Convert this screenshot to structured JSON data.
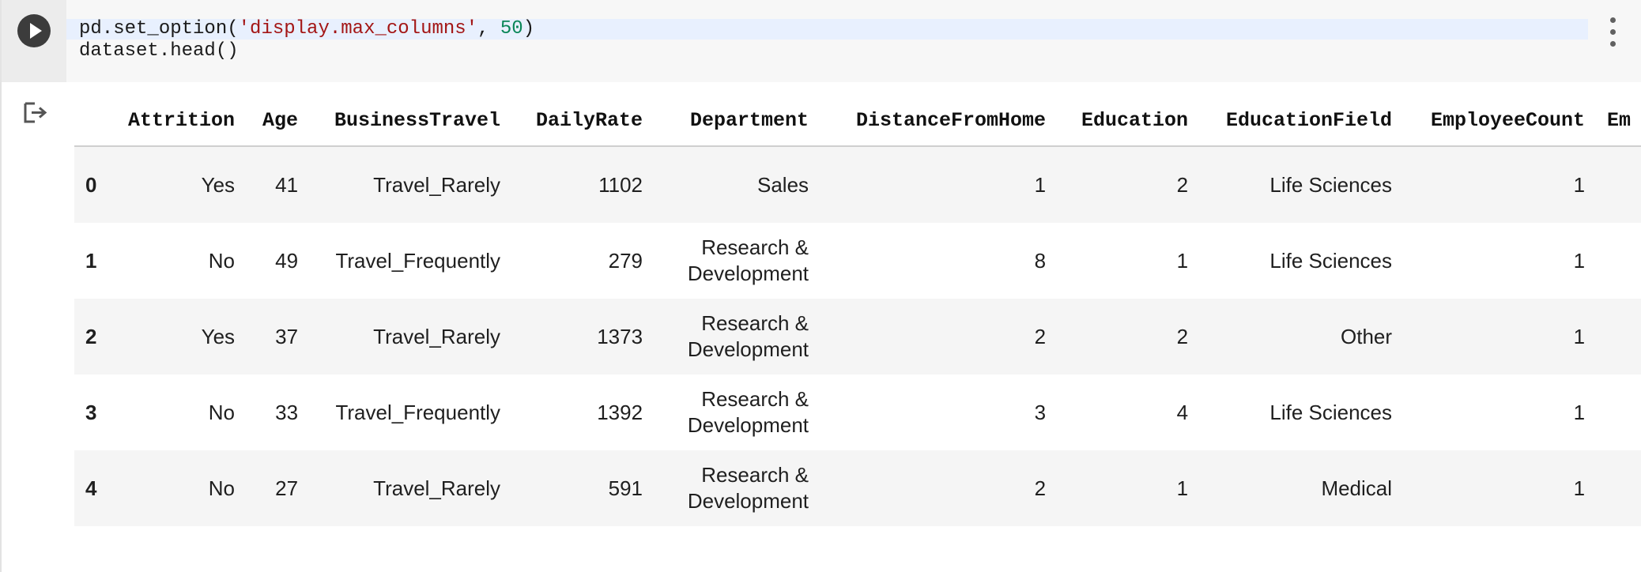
{
  "code_cell": {
    "line1": {
      "prefix": "pd.set_option(",
      "string": "'display.max_columns'",
      "separator": ", ",
      "number": "50",
      "suffix": ")"
    },
    "line2": "dataset.head()"
  },
  "icons": {
    "run": "play-icon",
    "menu": "more-vertical-icon",
    "output": "output-redirect-icon"
  },
  "colors": {
    "gutter_bg": "#ececec",
    "input_bg": "#f7f7f7",
    "current_line_bg": "#e8f0fe",
    "string_token": "#a31515",
    "number_token": "#098658",
    "row_stripe": "#f5f5f5"
  },
  "table": {
    "columns": [
      "Attrition",
      "Age",
      "BusinessTravel",
      "DailyRate",
      "Department",
      "DistanceFromHome",
      "Education",
      "EducationField",
      "EmployeeCount",
      "Em"
    ],
    "rows": [
      {
        "index": "0",
        "Attrition": "Yes",
        "Age": "41",
        "BusinessTravel": "Travel_Rarely",
        "DailyRate": "1102",
        "Department": "Sales",
        "DistanceFromHome": "1",
        "Education": "2",
        "EducationField": "Life Sciences",
        "EmployeeCount": "1"
      },
      {
        "index": "1",
        "Attrition": "No",
        "Age": "49",
        "BusinessTravel": "Travel_Frequently",
        "DailyRate": "279",
        "Department": "Research & Development",
        "DistanceFromHome": "8",
        "Education": "1",
        "EducationField": "Life Sciences",
        "EmployeeCount": "1"
      },
      {
        "index": "2",
        "Attrition": "Yes",
        "Age": "37",
        "BusinessTravel": "Travel_Rarely",
        "DailyRate": "1373",
        "Department": "Research & Development",
        "DistanceFromHome": "2",
        "Education": "2",
        "EducationField": "Other",
        "EmployeeCount": "1"
      },
      {
        "index": "3",
        "Attrition": "No",
        "Age": "33",
        "BusinessTravel": "Travel_Frequently",
        "DailyRate": "1392",
        "Department": "Research & Development",
        "DistanceFromHome": "3",
        "Education": "4",
        "EducationField": "Life Sciences",
        "EmployeeCount": "1"
      },
      {
        "index": "4",
        "Attrition": "No",
        "Age": "27",
        "BusinessTravel": "Travel_Rarely",
        "DailyRate": "591",
        "Department": "Research & Development",
        "DistanceFromHome": "2",
        "Education": "1",
        "EducationField": "Medical",
        "EmployeeCount": "1"
      }
    ]
  }
}
